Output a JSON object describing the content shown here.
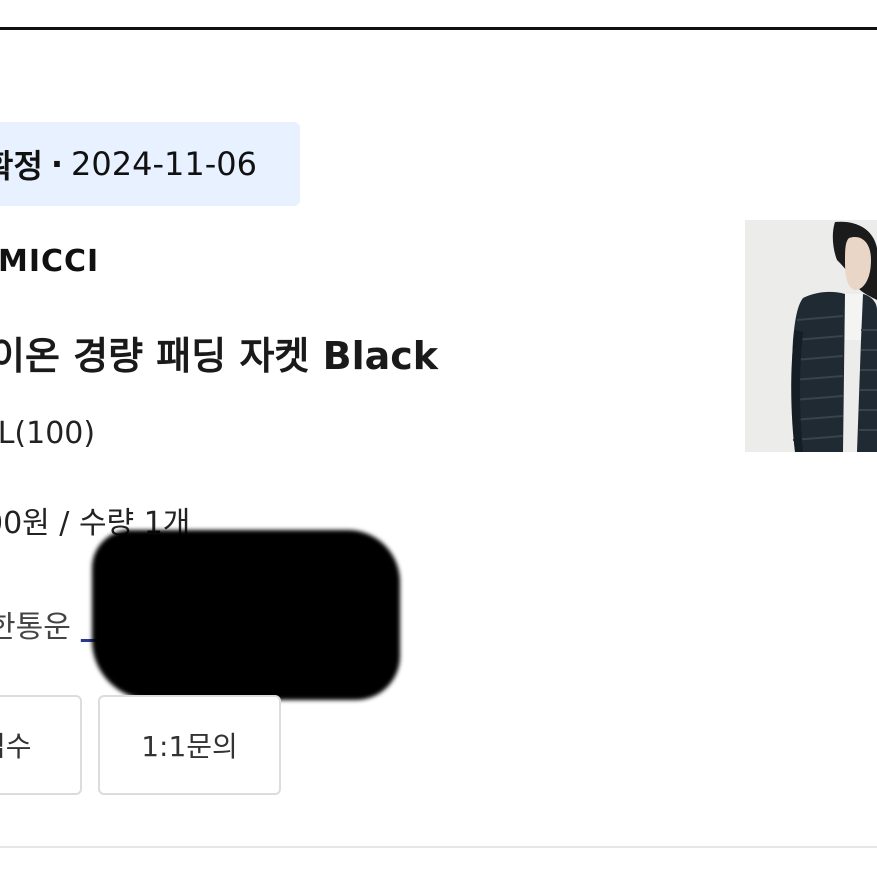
{
  "order": {
    "status": "확정",
    "separator": "·",
    "date": "2024-11-06"
  },
  "product": {
    "brand": "MICCI",
    "name": "이온 경량 패딩 자켓 Black",
    "option": "]L(100)",
    "price_qty": "00원 / 수량 1개",
    "shipping_carrier": "한통운",
    "tracking_visible": "6"
  },
  "actions": {
    "receipt_label": "접수",
    "inquiry_label": "1:1문의"
  },
  "colors": {
    "chip_background": "#e8f1ff",
    "link": "#2b3a8f",
    "jacket": "#1f2a33"
  },
  "icons": {
    "product_thumbnail": "jacket-photo"
  }
}
